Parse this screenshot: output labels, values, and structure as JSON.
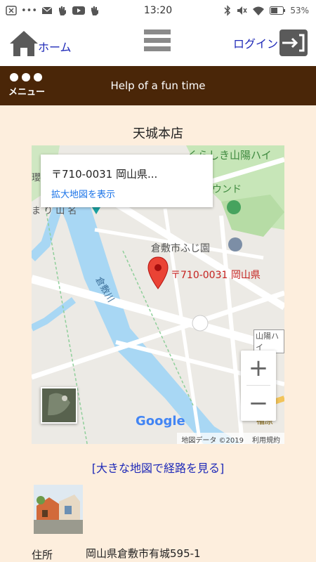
{
  "status_bar": {
    "time": "13:20",
    "battery": "53%",
    "dots": "•••"
  },
  "header": {
    "home_label": "ホーム",
    "login_label": "ログイン",
    "menu_label": "メニュー",
    "tagline": "Help of a fun time"
  },
  "store": {
    "title": "天城本店"
  },
  "map": {
    "info_address": "〒710-0031 岡山県...",
    "info_link": "拡大地図を表示",
    "marker_label": "〒710-0031 岡山県",
    "place_top": "くらしき山陽ハイ",
    "place_sound": "ウンド",
    "place_park": "倉敷市ふじ園",
    "river": "倉敷川",
    "road_label": "山陽ハイ",
    "road_south": "福原",
    "left_label_1": "瓔",
    "left_label_2": "ま り 山 名",
    "zoom_in": "+",
    "zoom_out": "−",
    "google": "Google",
    "map_data": "地図データ ©2019",
    "terms": "利用規約"
  },
  "links": {
    "big_map": "[大きな地図で経路を見る]"
  },
  "details": {
    "address_label": "住所",
    "address_value": "岡山県倉敷市有城595-1"
  }
}
